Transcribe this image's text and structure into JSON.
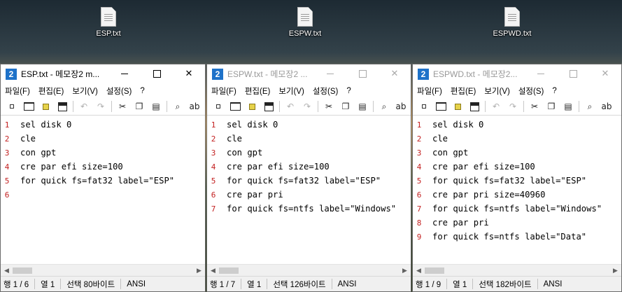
{
  "desktop": {
    "icons": [
      {
        "label": "ESP.txt"
      },
      {
        "label": "ESPW.txt"
      },
      {
        "label": "ESPWD.txt"
      }
    ]
  },
  "menu": [
    "파일(F)",
    "편집(E)",
    "보기(V)",
    "설정(S)",
    "?"
  ],
  "toolbar_icons": [
    "new-icon",
    "open-icon",
    "reload-icon",
    "save-icon",
    "undo-icon",
    "redo-icon",
    "cut-icon",
    "copy-icon",
    "paste-icon",
    "find-icon",
    "replace-icon"
  ],
  "windows": [
    {
      "title": "ESP.txt - 메모장2 m...",
      "active": true,
      "lines": [
        "sel disk 0",
        "cle",
        "con gpt",
        "cre par efi size=100",
        "for quick fs=fat32 label=\"ESP\"",
        ""
      ],
      "line_numbers": [
        "1",
        "2",
        "3",
        "4",
        "5",
        "6"
      ],
      "status": {
        "position": "행 1 / 6",
        "column": "열 1",
        "selection": "선택 80바이트",
        "encoding": "ANSI"
      }
    },
    {
      "title": "ESPW.txt - 메모장2 ...",
      "active": false,
      "lines": [
        "sel disk 0",
        "cle",
        "con gpt",
        "cre par efi size=100",
        "for quick fs=fat32 label=\"ESP\"",
        "cre par pri",
        "for quick fs=ntfs label=\"Windows\""
      ],
      "line_numbers": [
        "1",
        "2",
        "3",
        "4",
        "5",
        "6",
        "7"
      ],
      "status": {
        "position": "행 1 / 7",
        "column": "열 1",
        "selection": "선택 126바이트",
        "encoding": "ANSI"
      }
    },
    {
      "title": "ESPWD.txt - 메모장2...",
      "active": false,
      "lines": [
        "sel disk 0",
        "cle",
        "con gpt",
        "cre par efi size=100",
        "for quick fs=fat32 label=\"ESP\"",
        "cre par pri size=40960",
        "for quick fs=ntfs label=\"Windows\"",
        "cre par pri",
        "for quick fs=ntfs label=\"Data\""
      ],
      "line_numbers": [
        "1",
        "2",
        "3",
        "4",
        "5",
        "6",
        "7",
        "8",
        "9"
      ],
      "status": {
        "position": "행 1 / 9",
        "column": "열 1",
        "selection": "선택 182바이트",
        "encoding": "ANSI"
      }
    }
  ],
  "caption_buttons": {
    "minimize": "—",
    "maximize": "☐",
    "close": "✕"
  },
  "colors": {
    "app_icon": "#1e72c9",
    "line_number": "#c32020"
  }
}
